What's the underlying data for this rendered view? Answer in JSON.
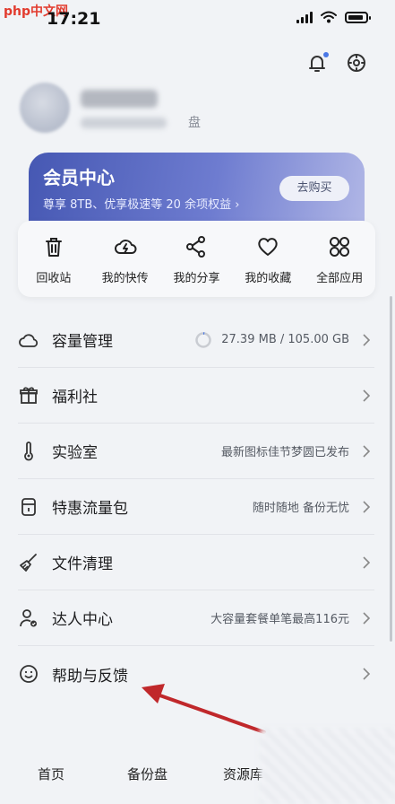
{
  "status_bar": {
    "watermark": "php中文网",
    "time": "17:21"
  },
  "profile": {
    "pan_label": "盘"
  },
  "vip": {
    "title": "会员中心",
    "desc": "尊享 8TB、优享极速等 20 余项权益 ›",
    "buy_label": "去购买"
  },
  "quick": [
    {
      "label": "回收站",
      "icon": "trash-icon"
    },
    {
      "label": "我的快传",
      "icon": "cloud-lightning-icon"
    },
    {
      "label": "我的分享",
      "icon": "share-icon"
    },
    {
      "label": "我的收藏",
      "icon": "heart-icon"
    },
    {
      "label": "全部应用",
      "icon": "grid-icon"
    }
  ],
  "menu": [
    {
      "label": "容量管理",
      "extra": "27.39 MB / 105.00 GB",
      "icon": "cloud-icon"
    },
    {
      "label": "福利社",
      "extra": "",
      "icon": "gift-icon"
    },
    {
      "label": "实验室",
      "extra": "最新图标佳节梦圆已发布",
      "icon": "thermometer-icon"
    },
    {
      "label": "特惠流量包",
      "extra": "随时随地 备份无忧",
      "icon": "package-icon"
    },
    {
      "label": "文件清理",
      "extra": "",
      "icon": "broom-icon"
    },
    {
      "label": "达人中心",
      "extra": "大容量套餐单笔最高116元",
      "icon": "person-badge-icon"
    },
    {
      "label": "帮助与反馈",
      "extra": "",
      "icon": "smile-icon"
    }
  ],
  "storage": {
    "used_fraction": 0.0003
  },
  "bottom_nav": {
    "tabs": [
      "首页",
      "备份盘",
      "资源库"
    ]
  },
  "colors": {
    "accent": "#4658b3",
    "arrow": "#c0282b"
  }
}
